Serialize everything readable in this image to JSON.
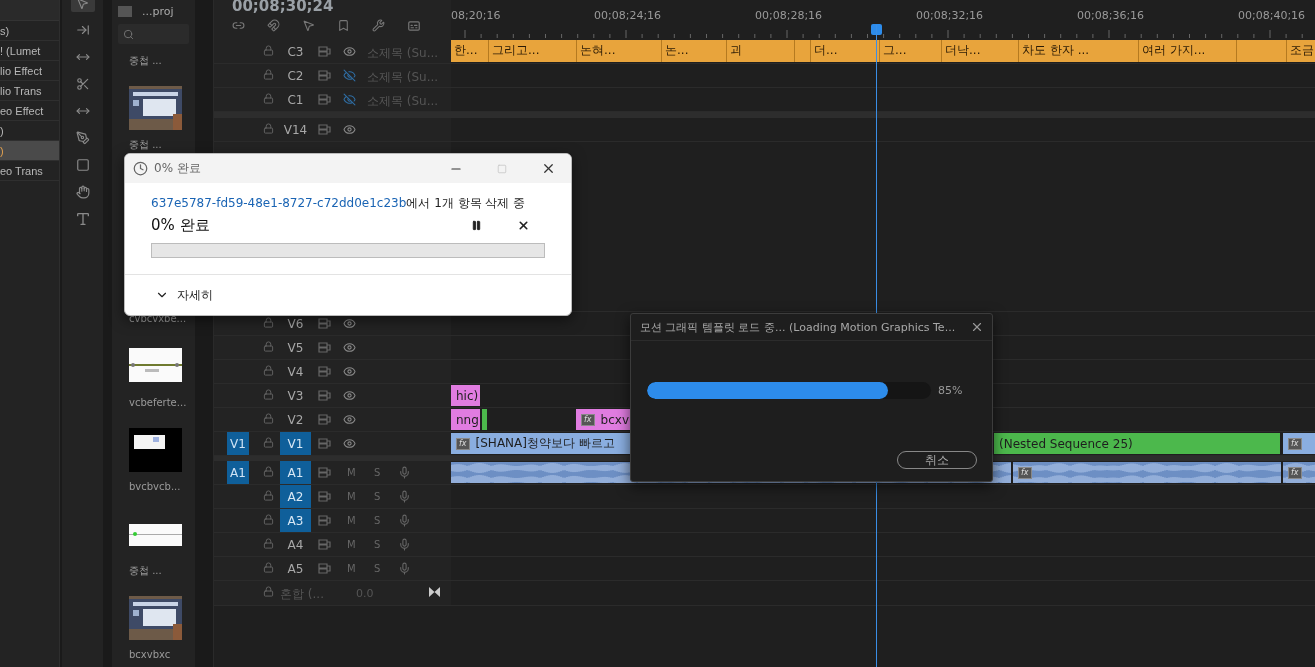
{
  "effects_panel": {
    "items": [
      {
        "label": "s)",
        "selected": false
      },
      {
        "label": "! (Lumet",
        "selected": false
      },
      {
        "label": "lio Effect",
        "selected": false
      },
      {
        "label": "lio Trans",
        "selected": false
      },
      {
        "label": "eo Effect",
        "selected": false
      },
      {
        "label": ")",
        "selected": false
      },
      {
        "label": ")",
        "selected": true
      },
      {
        "label": "eo Trans",
        "selected": false
      }
    ]
  },
  "project_panel": {
    "title": "...proj",
    "top_label": "중첩 ...",
    "items": [
      {
        "kind": "picture",
        "label": "중첩 ..."
      },
      {
        "kind": "text",
        "label": "cvbcvxbe..."
      },
      {
        "kind": "picture",
        "label": "vcbeferte..."
      },
      {
        "kind": "picture",
        "label": "bvcbvcb..."
      },
      {
        "kind": "picture",
        "label": "중첩 ..."
      },
      {
        "kind": "picture",
        "label": "bcxvbxc"
      }
    ]
  },
  "timeline": {
    "timecode": "00;08;30;24",
    "ruler": [
      "08;20;16",
      "00;08;24;16",
      "00;08;28;16",
      "00;08;32;16",
      "00;08;36;16",
      "00;08;40;16"
    ],
    "tracks": [
      {
        "kind": "caption",
        "name": "C3",
        "visible": true,
        "title": "소제목 (Su...",
        "segments": [
          {
            "kind": "text",
            "text": "한..."
          },
          {
            "kind": "text",
            "text": "그리고..."
          },
          {
            "kind": "text",
            "text": "논혀..."
          },
          {
            "kind": "text",
            "text": "논..."
          },
          {
            "kind": "text",
            "text": "괴"
          },
          {
            "kind": "empty"
          },
          {
            "kind": "text",
            "text": "더..."
          },
          {
            "kind": "text",
            "text": "그..."
          },
          {
            "kind": "text",
            "text": "더낙..."
          },
          {
            "kind": "text",
            "text": "차도 한자 ..."
          },
          {
            "kind": "text",
            "text": "여러 가지..."
          },
          {
            "kind": "empty"
          },
          {
            "kind": "text",
            "text": "조금"
          }
        ]
      },
      {
        "kind": "caption",
        "name": "C2",
        "visible": false,
        "title": "소제목 (Su..."
      },
      {
        "kind": "caption",
        "name": "C1",
        "visible": false,
        "title": "소제목 (Su..."
      },
      {
        "kind": "video",
        "name": "V14",
        "visible": true,
        "targeted": false
      },
      {
        "kind": "video",
        "name": "V6",
        "visible": true,
        "targeted": false
      },
      {
        "kind": "video",
        "name": "V5",
        "visible": true,
        "targeted": false
      },
      {
        "kind": "video",
        "name": "V4",
        "visible": true,
        "targeted": false
      },
      {
        "kind": "video",
        "name": "V3",
        "visible": true,
        "targeted": false,
        "clips": [
          {
            "kind": "graphic",
            "label": "hic)"
          }
        ]
      },
      {
        "kind": "video",
        "name": "V2",
        "visible": true,
        "targeted": false,
        "clips": [
          {
            "kind": "graphic",
            "label": "nng"
          },
          {
            "kind": "nested"
          },
          {
            "kind": "graphic",
            "label": "bcxv",
            "badge": "fx"
          }
        ]
      },
      {
        "kind": "video",
        "name": "V1",
        "source": "V1",
        "visible": true,
        "targeted": true,
        "clips": [
          {
            "kind": "video",
            "label": "[SHANA]청약보다 빠르고",
            "badge": "fx"
          },
          {
            "kind": "nested",
            "label": "(Nested Sequence 25)"
          },
          {
            "kind": "video",
            "badge": "fx"
          }
        ]
      },
      {
        "kind": "audio",
        "name": "A1",
        "source": "A1",
        "targeted": true,
        "mute": "M",
        "solo": "S",
        "clips": [
          {
            "kind": "audio"
          },
          {
            "kind": "audio",
            "badge": "fx"
          },
          {
            "kind": "audio",
            "badge": "fx"
          }
        ]
      },
      {
        "kind": "audio",
        "name": "A2",
        "targeted": true,
        "mute": "M",
        "solo": "S"
      },
      {
        "kind": "audio",
        "name": "A3",
        "targeted": true,
        "mute": "M",
        "solo": "S"
      },
      {
        "kind": "audio",
        "name": "A4",
        "targeted": false,
        "mute": "M",
        "solo": "S"
      },
      {
        "kind": "audio",
        "name": "A5",
        "targeted": false,
        "mute": "M",
        "solo": "S"
      }
    ],
    "mix": {
      "label": "혼합 (...",
      "value": "0.0"
    }
  },
  "delete_dialog": {
    "title": "0% 완료",
    "link": "637e5787-fd59-48e1-8727-c72dd0e1c23b",
    "message": "에서 1개 항목 삭제 중",
    "heading": "0% 완료",
    "level": 0,
    "details": "자세히"
  },
  "loading_dialog": {
    "title": "모션 그래픽 템플릿 로드 중... (Loading Motion Graphics Te...",
    "level": 0.85,
    "reading": "85%",
    "cancel": "취소"
  }
}
